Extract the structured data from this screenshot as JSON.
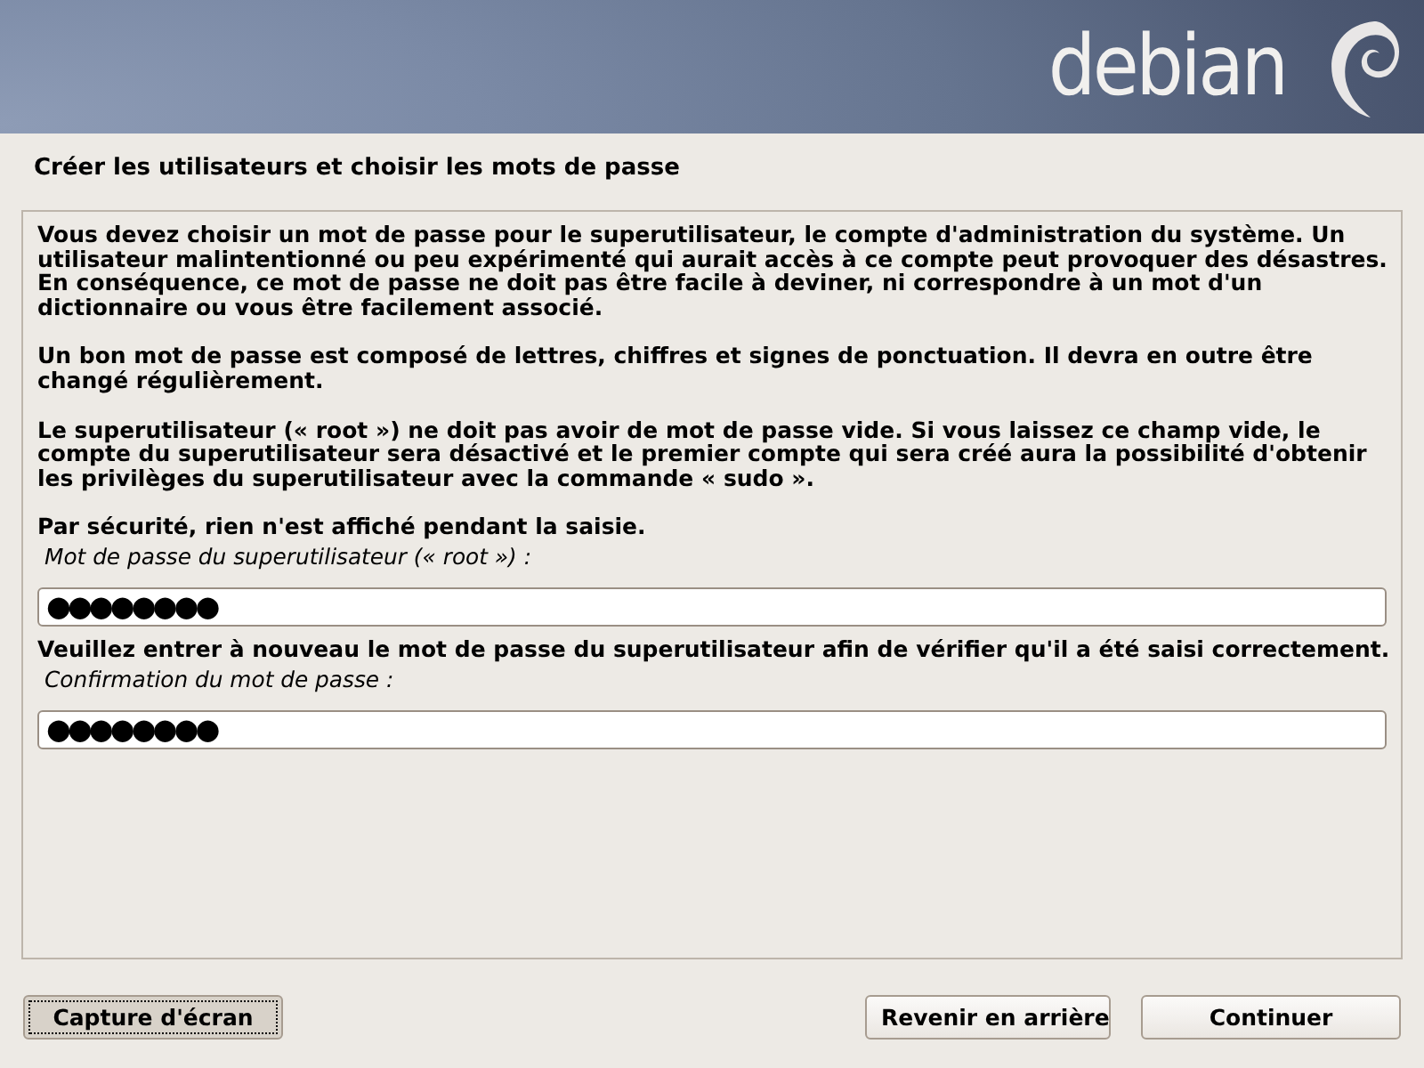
{
  "header": {
    "logo_text": "debian"
  },
  "title": "Créer les utilisateurs et choisir les mots de passe",
  "paragraphs": [
    "Vous devez choisir un mot de passe pour le superutilisateur, le compte d'administration du système. Un utilisateur malintentionné ou peu expérimenté qui aurait accès à ce compte peut provoquer des désastres. En conséquence, ce mot de passe ne doit pas être facile à deviner, ni correspondre à un mot d'un dictionnaire ou vous être facilement associé.",
    "Un bon mot de passe est composé de lettres, chiffres et signes de ponctuation. Il devra en outre être changé régulièrement.",
    "Le superutilisateur (« root ») ne doit pas avoir de mot de passe vide. Si vous laissez ce champ vide, le compte du superutilisateur sera désactivé et le premier compte qui sera créé aura la possibilité d'obtenir les privilèges du superutilisateur avec la commande « sudo ».",
    "Par sécurité, rien n'est affiché pendant la saisie."
  ],
  "fields": [
    {
      "label": "Mot de passe du superutilisateur (« root ») :",
      "value": "●●●●●●●●"
    },
    {
      "intro": "Veuillez entrer à nouveau le mot de passe du superutilisateur afin de vérifier qu'il a été saisi correctement.",
      "label": "Confirmation du mot de passe :",
      "value": "●●●●●●●●"
    }
  ],
  "left_buttons": [
    {
      "label": "Capture d'écran",
      "focused": true
    }
  ],
  "right_buttons": [
    {
      "label": "Revenir en arrière",
      "focused": false
    },
    {
      "label": "Continuer",
      "focused": false
    }
  ]
}
